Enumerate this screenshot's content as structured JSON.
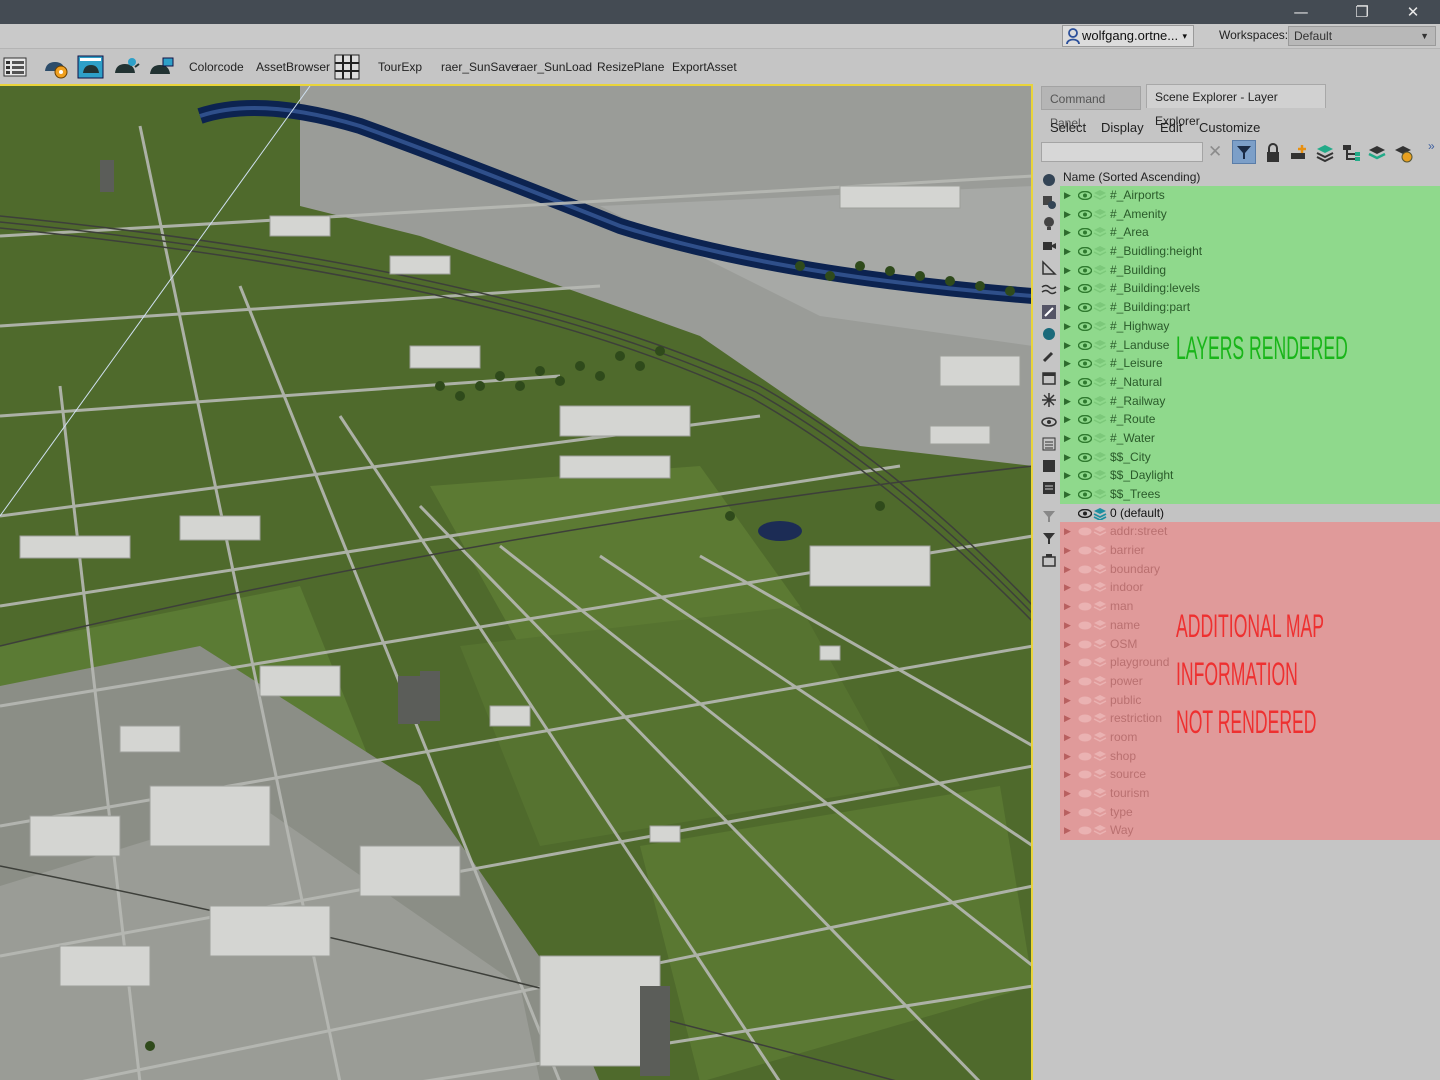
{
  "window": {
    "minimize": "—",
    "restore": "❐",
    "close": "✕"
  },
  "userbar": {
    "user": "wolfgang.ortne...",
    "user_dropdown": "▾",
    "workspaces_label": "Workspaces:",
    "workspace_value": "Default",
    "workspace_dropdown": "▼"
  },
  "toolbar": {
    "icons": [
      "layer-manager-icon",
      "render-setup-icon",
      "teapot-render-icon",
      "teapot-settings-icon",
      "teapot-frame-icon"
    ],
    "colorcode": "Colorcode",
    "assetbrowser": "AssetBrowser",
    "grid_icon": "grid-tool-icon",
    "tourexp": "TourExp",
    "sunsave": "raer_SunSave",
    "sunload": "raer_SunLoad",
    "resizeplane": "ResizePlane",
    "exportasset": "ExportAsset"
  },
  "panel": {
    "tabs": [
      "Command Panel",
      "Scene Explorer - Layer Explorer"
    ],
    "menu": [
      "Select",
      "Display",
      "Edit",
      "Customize"
    ],
    "search_placeholder": "",
    "clear": "✕",
    "more": "»",
    "column_header": "Name (Sorted Ascending)",
    "rendered_layers": [
      "#_Airports",
      "#_Amenity",
      "#_Area",
      "#_Buidling:height",
      "#_Building",
      "#_Building:levels",
      "#_Building:part",
      "#_Highway",
      "#_Landuse",
      "#_Leisure",
      "#_Natural",
      "#_Railway",
      "#_Route",
      "#_Water",
      "$$_City",
      "$$_Daylight",
      "$$_Trees"
    ],
    "default_layer": "0 (default)",
    "hidden_layers": [
      "addr:street",
      "barrier",
      "boundary",
      "indoor",
      "man",
      "name",
      "OSM",
      "playground",
      "power",
      "public",
      "restriction",
      "room",
      "shop",
      "source",
      "tourism",
      "type",
      "Way"
    ]
  },
  "annotations": {
    "rendered": "LAYERS RENDERED",
    "not_rendered_1": "ADDITIONAL MAP",
    "not_rendered_2": "INFORMATION",
    "not_rendered_3": "NOT RENDERED"
  },
  "colors": {
    "rendered_row": "#8fd98c",
    "hidden_row": "#e09a9a",
    "viewport_border": "#e9d43a",
    "annotation_green": "#19b519",
    "annotation_red": "#ee3030"
  }
}
